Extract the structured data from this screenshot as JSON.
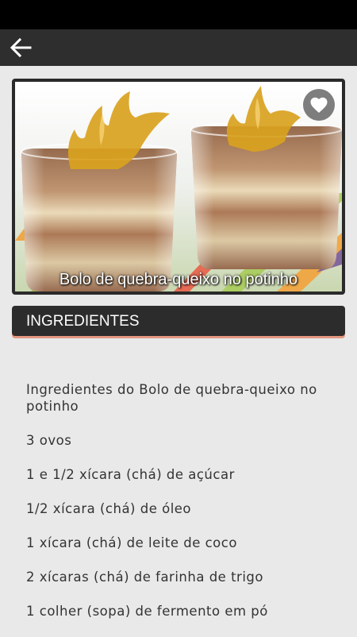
{
  "app": {
    "back_icon": "arrow-left-icon",
    "favorite_icon": "heart-icon"
  },
  "recipe": {
    "title": "Bolo de quebra-queixo no potinho",
    "section_title": "INGREDIENTES",
    "ingredients": [
      "Ingredientes do Bolo de quebra-queixo no potinho",
      "3 ovos",
      "1 e 1/2 xícara (chá) de açúcar",
      "1/2 xícara (chá) de óleo",
      "1 xícara (chá) de leite de coco",
      "2 xícaras (chá) de farinha de trigo",
      "1 colher (sopa) de fermento em pó"
    ]
  },
  "colors": {
    "statusbar": "#000000",
    "appbar": "#2e2e2e",
    "section_bar": "#2c2c2c",
    "accent_underline": "#e4967f",
    "background": "#e9e9e9"
  }
}
